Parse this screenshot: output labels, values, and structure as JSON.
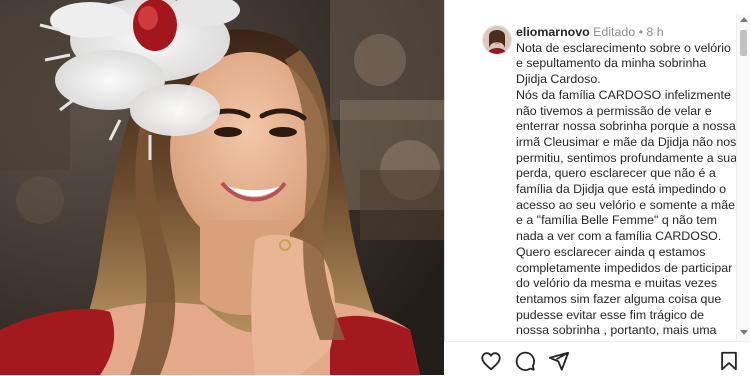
{
  "post": {
    "photo_alt": "photo-of-woman-with-feather-headpiece",
    "comment": {
      "username": "eliomarnovo",
      "edited": "Editado",
      "separator": "•",
      "time": "8 h",
      "text": "Nota de esclarecimento sobre o velório e sepultamento da minha sobrinha Djidja Cardoso.\nNós da família CARDOSO infelizmente não tivemos a permissão de velar e enterrar nossa sobrinha porque a nossa irmã Cleusimar e mãe da Djidja não nos permitiu, sentimos profundamente a sua perda, quero esclarecer que não é a família da Djidja que está impedindo o acesso ao seu velório e somente a mãe e a \"família Belle Femme\" q não tem nada a ver com a família CARDOSO. Quero esclarecer ainda q estamos completamente impedidos de participar do velório da mesma e muitas vezes tentamos sim fazer alguma coisa que pudesse evitar esse fim trágico de nossa sobrinha , portanto, mais uma vez a \"família Belle Femme\" não é a"
    },
    "actions": [
      "like-icon",
      "comment-icon",
      "share-icon",
      "save-icon"
    ]
  },
  "colors": {
    "text": "#262626",
    "muted": "#8e8e8e",
    "border": "#dbdbdb"
  }
}
